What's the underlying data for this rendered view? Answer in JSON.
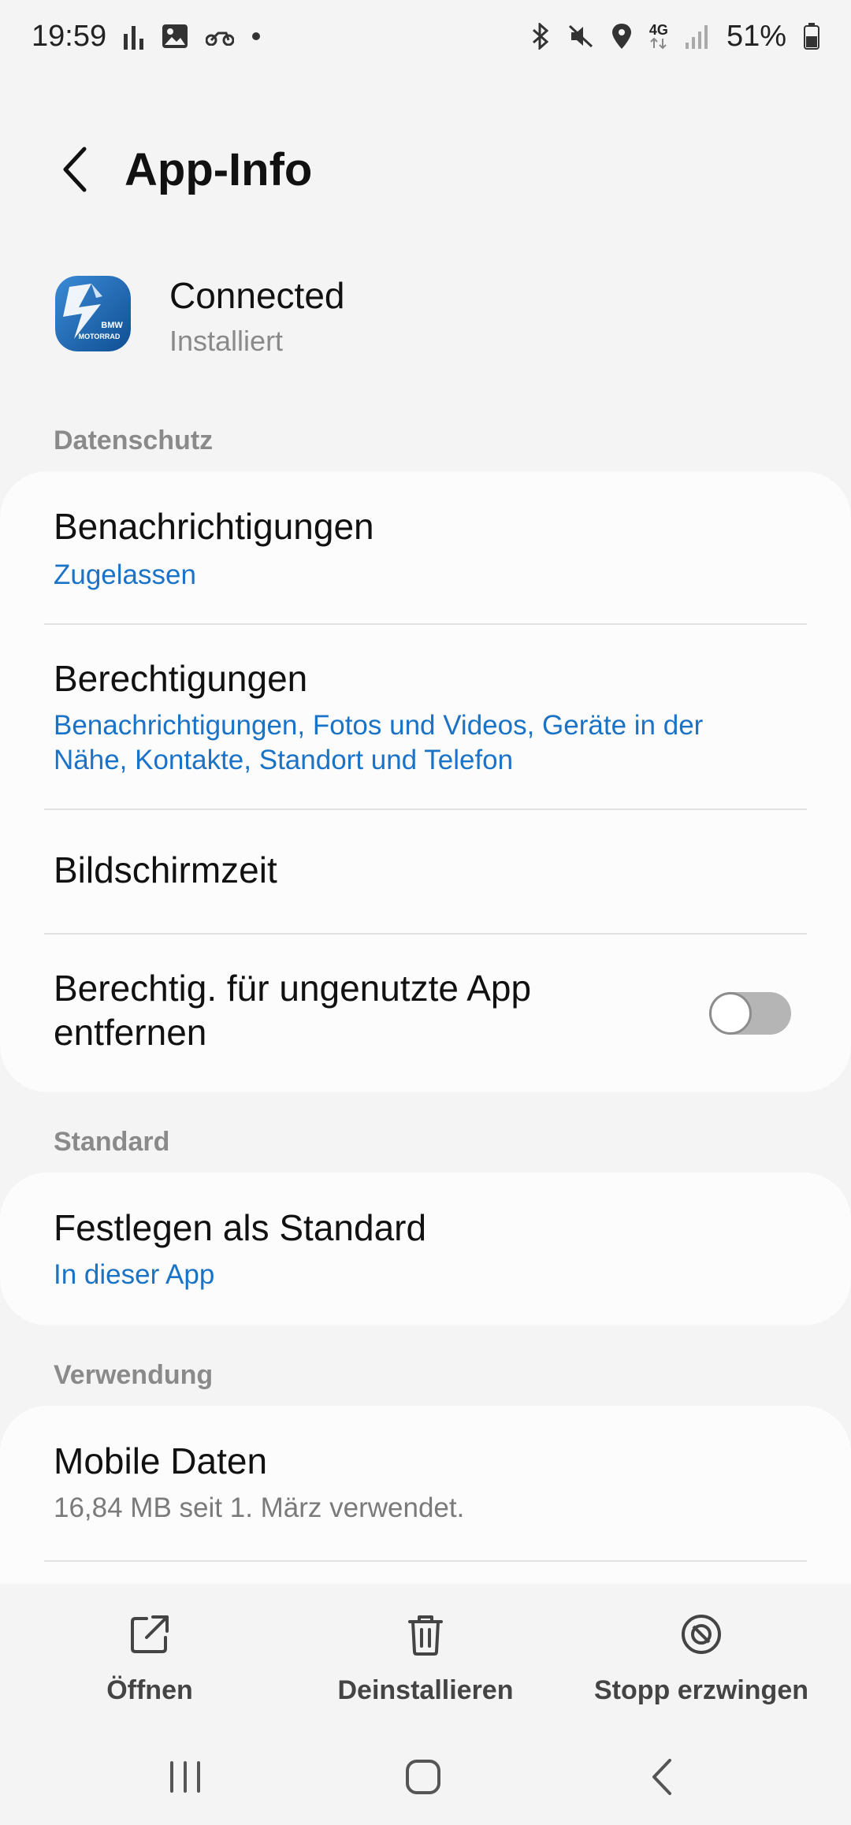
{
  "status_bar": {
    "time": "19:59",
    "battery": "51%",
    "network_label": "4G",
    "left_icons": [
      "signal-bars-icon",
      "gallery-icon",
      "motorcycle-icon",
      "dot-icon"
    ],
    "right_icons": [
      "bluetooth-icon",
      "mute-icon",
      "location-icon",
      "network-4g-icon",
      "signal-icon",
      "battery-icon"
    ]
  },
  "header": {
    "title": "App-Info",
    "back_icon": "chevron-left-icon"
  },
  "app": {
    "name": "Connected",
    "status": "Installiert",
    "icon_text_line1": "BMW",
    "icon_text_line2": "MOTORRAD"
  },
  "sections": {
    "privacy": "Datenschutz",
    "default": "Standard",
    "usage": "Verwendung"
  },
  "privacy_items": [
    {
      "title": "Benachrichtigungen",
      "subtitle": "Zugelassen"
    },
    {
      "title": "Berechtigungen",
      "subtitle_line1": "Benachrichtigungen, Fotos und Videos, Geräte in der",
      "subtitle_line2": "Nähe, Kontakte, Standort und Telefon"
    },
    {
      "title": "Bildschirmzeit"
    },
    {
      "title_line1": "Berechtig. für ungenutzte App",
      "title_line2": "entfernen",
      "toggle_on": false
    }
  ],
  "default_items": [
    {
      "title": "Festlegen als Standard",
      "subtitle": "In dieser App"
    }
  ],
  "usage_items": [
    {
      "title": "Mobile Daten",
      "subtitle": "16,84 MB seit 1. März verwendet."
    }
  ],
  "actions": [
    {
      "label": "Öffnen",
      "icon": "open-external-icon"
    },
    {
      "label": "Deinstallieren",
      "icon": "trash-icon"
    },
    {
      "label": "Stopp erzwingen",
      "icon": "block-icon"
    }
  ],
  "nav": [
    "recents-icon",
    "home-icon",
    "back-icon"
  ],
  "colors": {
    "accent": "#1a73c6",
    "background": "#f4f4f4",
    "card": "#fcfcfc",
    "app_icon": "#1e6db8"
  }
}
